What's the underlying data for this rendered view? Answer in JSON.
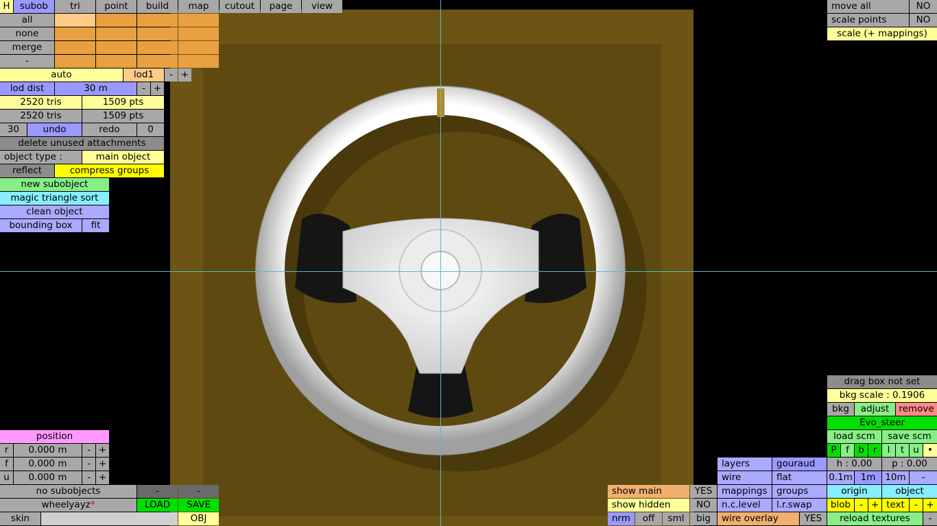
{
  "menu_bar": {
    "h": "H",
    "tabs": [
      "subob",
      "tri",
      "point",
      "build",
      "map",
      "cutout",
      "page",
      "view"
    ]
  },
  "subob_rows": [
    "all",
    "none",
    "merge",
    "-"
  ],
  "lod": {
    "auto": "auto",
    "lod_name": "lod1",
    "minus": "-",
    "plus": "+",
    "dist_label": "lod dist",
    "dist_value": "30 m"
  },
  "counts": {
    "tris1": "2520 tris",
    "pts1": "1509 pts",
    "tris2": "2520 tris",
    "pts2": "1509 pts"
  },
  "undo_row": {
    "steps": "30",
    "undo": "undo",
    "redo": "redo",
    "redo_count": "0"
  },
  "actions": {
    "delete_unused": "delete unused attachments",
    "object_type_label": "object type :",
    "object_type_value": "main object",
    "reflect": "reflect",
    "compress_groups": "compress groups",
    "new_subobject": "new subobject",
    "magic_sort": "magic triangle sort",
    "clean_object": "clean object",
    "bounding_box": "bounding box",
    "fit": "fit"
  },
  "top_right": {
    "move_all": "move all",
    "move_all_value": "NO",
    "scale_points": "scale points",
    "scale_points_value": "NO",
    "scale_mappings": "scale (+ mappings)"
  },
  "position": {
    "title": "position",
    "rows": [
      {
        "axis": "r",
        "value": "0.000 m"
      },
      {
        "axis": "f",
        "value": "0.000 m"
      },
      {
        "axis": "u",
        "value": "0.000 m"
      }
    ]
  },
  "bottom_left": {
    "no_subobjects": "no subobjects",
    "file_name": "wheelyayz",
    "modified_mark": "*",
    "load": "LOAD",
    "save": "SAVE",
    "skin": "skin",
    "obj": "OBJ"
  },
  "show_panel": {
    "show_main": "show main",
    "show_main_value": "YES",
    "show_hidden": "show hidden",
    "show_hidden_value": "NO",
    "nrm": "nrm",
    "off": "off",
    "sml": "sml",
    "big": "big"
  },
  "layers_panel": {
    "layers": "layers",
    "gouraud": "gouraud",
    "wire": "wire",
    "flat": "flat",
    "mappings": "mappings",
    "groups": "groups",
    "nc_level": "n.c.level",
    "lr_swap": "l.r.swap",
    "wire_overlay": "wire overlay",
    "wire_overlay_value": "YES"
  },
  "bkg_panel": {
    "drag_box": "drag box not set",
    "bkg_scale": "bkg scale : 0.1906",
    "bkg": "bkg",
    "adjust": "adjust",
    "remove": "remove",
    "name": "Evo_steer",
    "load_scm": "load scm",
    "save_scm": "save scm",
    "view_letters": [
      "P",
      "f",
      "b",
      "r",
      "l",
      "t",
      "u",
      "•"
    ],
    "h": "h : 0.00",
    "p": "p : 0.00",
    "step_01": "0.1m",
    "step_1": "1m",
    "step_10": "10m",
    "minus": "-",
    "origin": "origin",
    "object": "object",
    "blob": "blob",
    "text": "text",
    "reload_textures": "reload textures"
  },
  "colors": {
    "wheel_rim": "#d8d8d8",
    "backdrop": "#6b5414",
    "crosshair": "#4ec0d0",
    "active_green": "#00e000"
  }
}
